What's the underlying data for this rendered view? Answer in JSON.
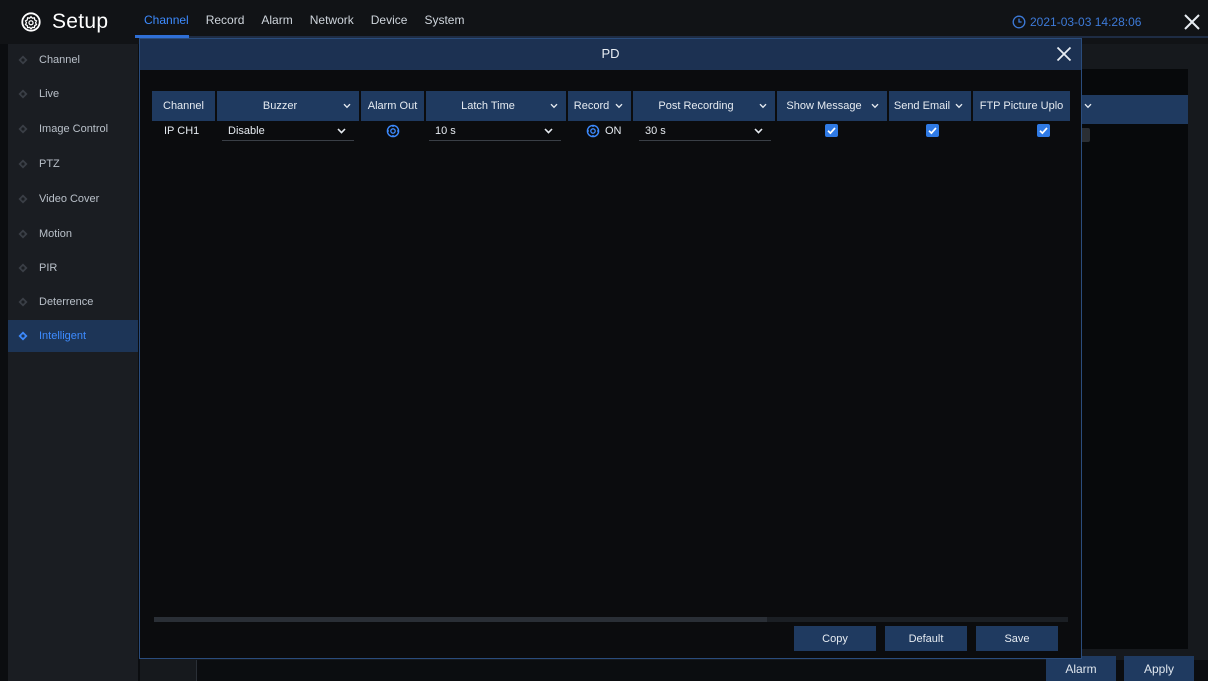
{
  "app": {
    "title": "Setup",
    "datetime": "2021-03-03 14:28:06"
  },
  "nav": {
    "tabs": [
      "Channel",
      "Record",
      "Alarm",
      "Network",
      "Device",
      "System"
    ],
    "active_tab": "Channel"
  },
  "sidebar": {
    "items": [
      "Channel",
      "Live",
      "Image Control",
      "PTZ",
      "Video Cover",
      "Motion",
      "PIR",
      "Deterrence",
      "Intelligent"
    ],
    "active_item": "Intelligent"
  },
  "background_page": {
    "alarm_button": "Alarm",
    "apply_button": "Apply"
  },
  "modal": {
    "title": "PD",
    "columns": {
      "channel": "Channel",
      "buzzer": "Buzzer",
      "alarm_out": "Alarm Out",
      "latch_time": "Latch Time",
      "record": "Record",
      "post_recording": "Post Recording",
      "show_message": "Show Message",
      "send_email": "Send Email",
      "ftp_upload": "FTP Picture Uplo"
    },
    "row": {
      "channel": "IP CH1",
      "buzzer": "Disable",
      "latch_time": "10 s",
      "record": "ON",
      "post_recording": "30 s",
      "show_message": true,
      "send_email": true,
      "ftp_upload": true
    },
    "buttons": {
      "copy": "Copy",
      "default": "Default",
      "save": "Save"
    }
  },
  "colors": {
    "accent": "#3d8bff",
    "header_bg": "#1f3a60",
    "checkbox": "#2f7ae5"
  },
  "icons": [
    "gear-icon",
    "clock-icon",
    "close-icon",
    "chevron-down-icon",
    "diamond-bullet-icon",
    "checkmark-icon"
  ]
}
